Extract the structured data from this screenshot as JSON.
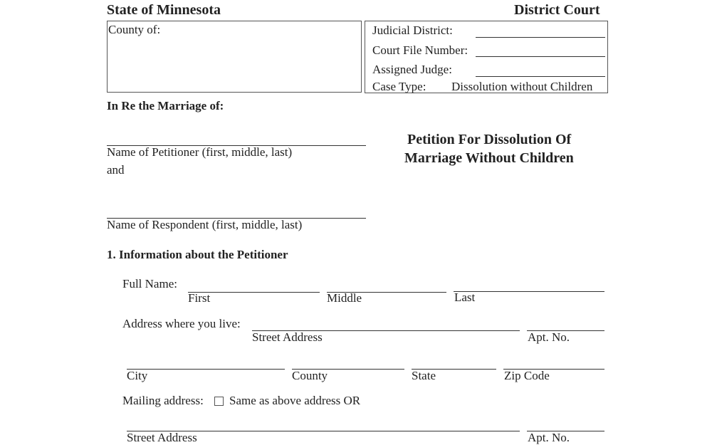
{
  "header": {
    "state": "State of Minnesota",
    "court": "District Court"
  },
  "county_box": {
    "label": "County of:",
    "value": ""
  },
  "case_box": {
    "judicial_district_label": "Judicial District:",
    "court_file_number_label": "Court File Number:",
    "assigned_judge_label": "Assigned Judge:",
    "case_type_label": "Case Type:",
    "case_type_value": "Dissolution without Children"
  },
  "caption": {
    "in_re": "In Re the Marriage of:",
    "petitioner_name_label": "Name of Petitioner (first, middle, last)",
    "and": "and",
    "respondent_name_label": "Name of Respondent (first, middle, last)"
  },
  "title": {
    "line1": "Petition For Dissolution Of",
    "line2": "Marriage Without Children"
  },
  "section1": {
    "heading": "1. Information about the Petitioner",
    "full_name_label": "Full Name:",
    "first_label": "First",
    "middle_label": "Middle",
    "last_label": "Last",
    "address_label": "Address where you live:",
    "street_label": "Street Address",
    "apt_label": "Apt. No.",
    "city_label": "City",
    "county_label": "County",
    "state_label": "State",
    "zip_label": "Zip Code",
    "mailing_label": "Mailing address:",
    "same_as_above_label": "Same as above address OR",
    "same_as_above_checked": false,
    "mailing_street_label": "Street Address",
    "mailing_apt_label": "Apt. No."
  }
}
